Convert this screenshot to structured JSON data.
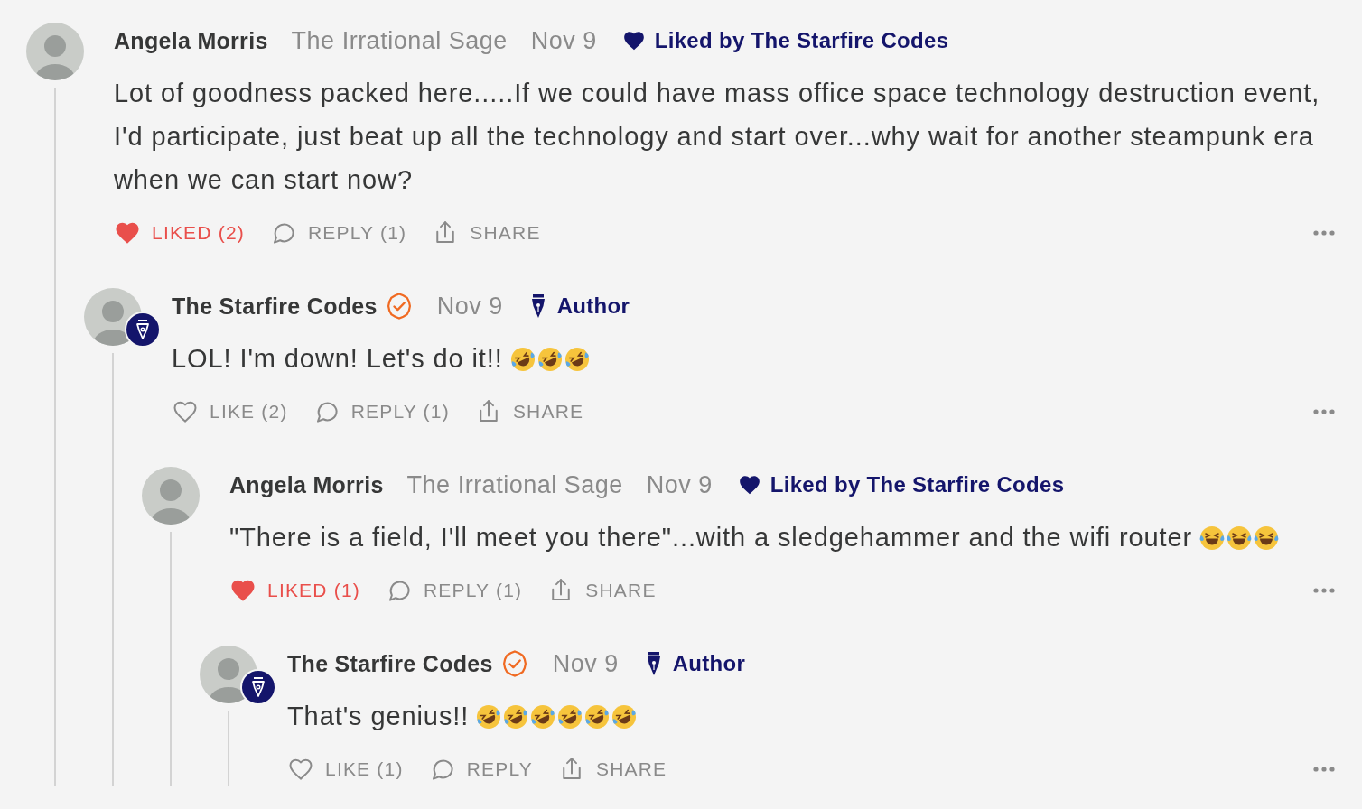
{
  "comments": [
    {
      "author": "Angela Morris",
      "verified": false,
      "avatar_badge": false,
      "publication": "The Irrational Sage",
      "date": "Nov 9",
      "tag": {
        "kind": "liked_by",
        "label": "Liked by The Starfire Codes"
      },
      "text": "Lot of goodness packed here.....If we could have mass office space technology destruction event, I'd participate, just beat up all the technology and start over...why wait for another steampunk era when we can start now?",
      "like": {
        "label": "LIKED (2)",
        "liked": true
      },
      "reply": "REPLY (1)",
      "share": "SHARE",
      "replies": [
        {
          "author": "The Starfire Codes",
          "verified": true,
          "avatar_badge": true,
          "date": "Nov 9",
          "tag": {
            "kind": "author",
            "label": "Author"
          },
          "text": "LOL! I'm down! Let's do it!!",
          "emoji": [
            {
              "kind": "rofl"
            },
            {
              "kind": "rofl"
            },
            {
              "kind": "rofl"
            }
          ],
          "like": {
            "label": "LIKE (2)",
            "liked": false
          },
          "reply": "REPLY (1)",
          "share": "SHARE",
          "replies": [
            {
              "author": "Angela Morris",
              "verified": false,
              "avatar_badge": false,
              "publication": "The Irrational Sage",
              "date": "Nov 9",
              "tag": {
                "kind": "liked_by",
                "label": "Liked by The Starfire Codes"
              },
              "text": "\"There is a field, I'll meet you there\"...with a sledgehammer and the wifi router",
              "emoji": [
                {
                  "kind": "joy"
                },
                {
                  "kind": "joy"
                },
                {
                  "kind": "joy"
                }
              ],
              "like": {
                "label": "LIKED (1)",
                "liked": true
              },
              "reply": "REPLY (1)",
              "share": "SHARE",
              "replies": [
                {
                  "author": "The Starfire Codes",
                  "verified": true,
                  "avatar_badge": true,
                  "date": "Nov 9",
                  "tag": {
                    "kind": "author",
                    "label": "Author"
                  },
                  "text": "That's genius!!",
                  "emoji": [
                    {
                      "kind": "rofl"
                    },
                    {
                      "kind": "rofl"
                    },
                    {
                      "kind": "rofl"
                    },
                    {
                      "kind": "rofl"
                    },
                    {
                      "kind": "rofl"
                    },
                    {
                      "kind": "rofl"
                    }
                  ],
                  "like": {
                    "label": "LIKE (1)",
                    "liked": false
                  },
                  "reply": "REPLY",
                  "share": "SHARE"
                }
              ]
            }
          ]
        }
      ]
    }
  ]
}
